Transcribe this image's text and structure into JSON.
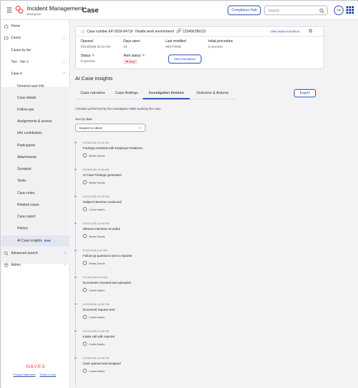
{
  "app": {
    "name": "Incident Management",
    "subtitle": "Enterprise",
    "page_title": "Case"
  },
  "header": {
    "compliance_hub": "Compliance Hub",
    "search_placeholder": "Search",
    "avatar_initials": "AB"
  },
  "sidebar": {
    "home": "Home",
    "cases": "Cases",
    "cases_by_tier": "Cases by tier",
    "tier": "Tier - Tier 1",
    "case_num": "Case #",
    "items": [
      "General case info",
      "Case details",
      "Follow-ups",
      "Assignments & access",
      "Info contributors",
      "Participants",
      "Attachments",
      "Synopsis",
      "Tasks",
      "Case notes",
      "Related cases",
      "Case report",
      "History",
      "AI Case insights"
    ],
    "new_badge": "New",
    "advanced_search": "Advanced search",
    "admin": "Admin",
    "brand": "NAVEX",
    "privacy": "Privacy Statement",
    "terms": "Terms of Use"
  },
  "case": {
    "case_number": "Case number EP-2026-04719",
    "case_type": "Hostile work environment",
    "phone": "123456789123",
    "view_status_transition": "View status transition",
    "opened_label": "Opened",
    "opened_value": "01/13/2026 10:12 AM",
    "days_open_label": "Days open",
    "days_open_value": "23",
    "last_modified_label": "Last modified",
    "last_modified_value": "06/17/2026",
    "initial_procedure_label": "Initial procedure",
    "initial_procedure_value": "In process",
    "status_label": "Status",
    "status_value": "In process",
    "alert_status_label": "Alert status",
    "alert_status_value": "Red",
    "new_translation": "New translation"
  },
  "insights": {
    "title": "AI Case insights",
    "tabs": [
      "Case narrative",
      "Case findings",
      "Investigation timeline",
      "Outcome & Actions"
    ],
    "selected_tab": "Investigation timeline",
    "export": "Export",
    "description": "Activities performed by the investigator while working the case.",
    "sort_label": "Sort by date",
    "sort_value": "Newest to oldest"
  },
  "timeline": [
    {
      "ts": "02/06/2026 10:00 AM",
      "title": "Findings reviewed with Employee Relations",
      "user": "Maria Garcia"
    },
    {
      "ts": "02/06/2026 10:00 AM",
      "title": "AI Case Findings generated",
      "user": "Maria Garcia"
    },
    {
      "ts": "02/01/2026 16:35 PM",
      "title": "Subject interview conducted",
      "user": "Curtis Martin"
    },
    {
      "ts": "02/01/2026 14:34 PM",
      "title": "Witness interview recorded",
      "user": "Maria Garcia"
    },
    {
      "ts": "01/27/2026 2:47 AM",
      "title": "Follow-up questions sent to reporter",
      "user": "Maria Garcia"
    },
    {
      "ts": "01/26/2026 8:20 AM",
      "title": "Documents received and uploaded",
      "user": "Curtis Martin"
    },
    {
      "ts": "01/23/2026 14:30 PM",
      "title": "Document request sent",
      "user": "Curtis Martin"
    },
    {
      "ts": "01/21/2026 14:33 PM",
      "title": "Intake call with reporter",
      "user": "Curtis Martin"
    },
    {
      "ts": "01/20/2026 14:30 PM",
      "title": "Case opened and assigned",
      "user": "Curtis Martin"
    }
  ]
}
